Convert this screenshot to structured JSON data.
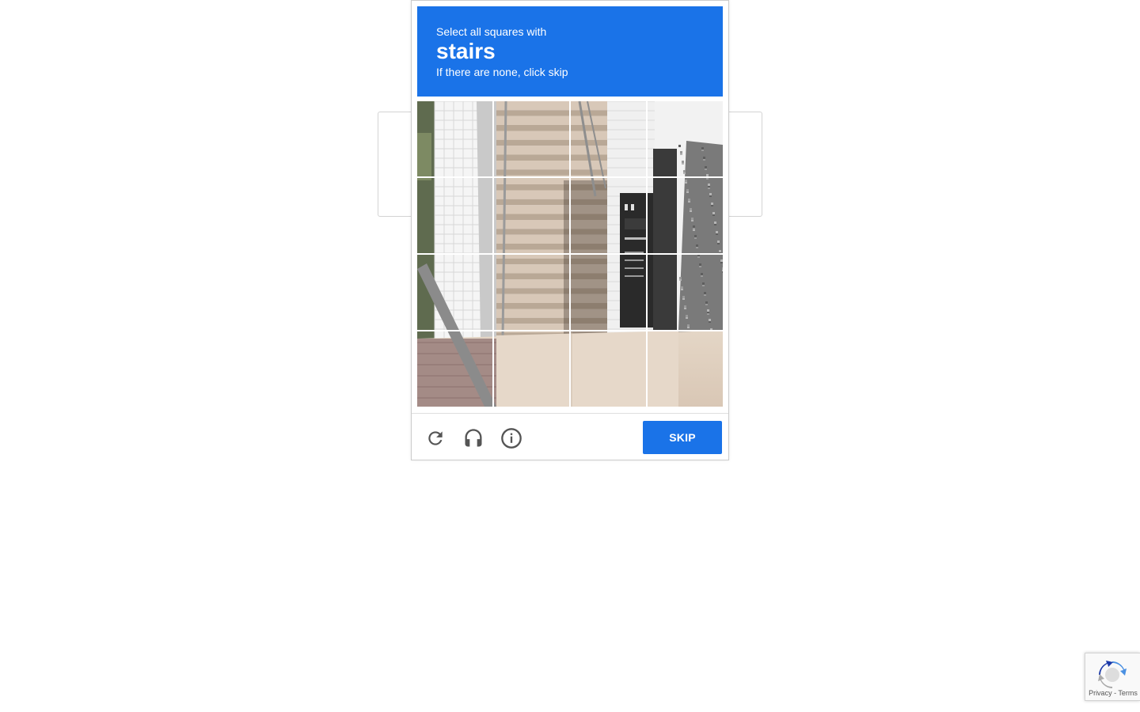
{
  "challenge": {
    "instruction_line1": "Select all squares with",
    "keyword": "stairs",
    "instruction_line3": "If there are none, click skip",
    "grid_rows": 4,
    "grid_cols": 4,
    "skip_label": "SKIP",
    "footer_icons": [
      "reload-icon",
      "audio-headphones-icon",
      "info-icon"
    ]
  },
  "badge": {
    "privacy_label": "Privacy",
    "separator": " - ",
    "terms_label": "Terms"
  },
  "colors": {
    "accent": "#1a73e8",
    "icon_gray": "#555555"
  }
}
